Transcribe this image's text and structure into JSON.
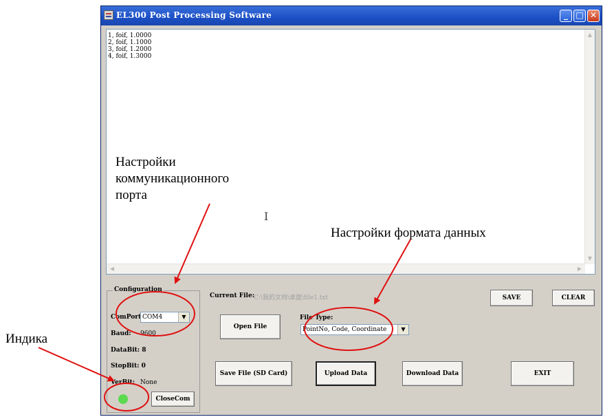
{
  "window": {
    "title": "EL300 Post Processing Software",
    "controls": {
      "minimize": "_",
      "maximize": "□",
      "close": "✕"
    }
  },
  "text_area": {
    "lines": [
      "1, foif, 1.0000",
      "2, foif, 1.1000",
      "3, foif, 1.2000",
      "4, foif, 1.3000"
    ],
    "cursor_glyph": "I"
  },
  "configuration": {
    "label": "Configuration",
    "comport_label": "ComPort:",
    "comport_value": "COM4",
    "baud_label": "Baud:",
    "baud_value": "9600",
    "databit_label": "DataBit: 8",
    "stopbit_label": "StopBit: 0",
    "verbit_label": "VerBit:",
    "verbit_value": "None",
    "close_com_label": "CloseCom"
  },
  "current_file": {
    "label": "Current File:",
    "path": "C:\\我的文档\\桌面\\file1.txt"
  },
  "file_type": {
    "label": "File Type:",
    "selected": "PointNo, Code, Coordinate"
  },
  "buttons": {
    "save": "SAVE",
    "clear": "CLEAR",
    "open_file": "Open File",
    "save_file_sd": "Save File (SD Card)",
    "upload_data": "Upload Data",
    "download_data": "Download Data",
    "exit": "EXIT"
  },
  "annotations": {
    "port_settings": [
      "Настройки",
      "коммуникационного",
      "порта"
    ],
    "data_format": "Настройки формата данных",
    "indicator": "Индика"
  },
  "colors": {
    "annotation_red": "#e01010",
    "led_green": "#5bd94f",
    "title_blue": "#1b4fc6"
  }
}
